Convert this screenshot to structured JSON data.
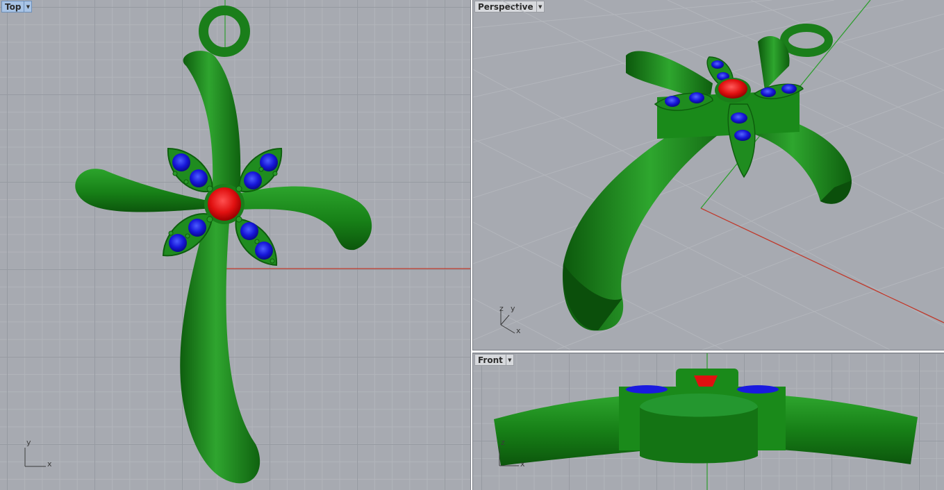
{
  "viewports": {
    "top": {
      "label": "Top",
      "axes": {
        "x": "x",
        "y": "y"
      }
    },
    "perspective": {
      "label": "Perspective",
      "axes": {
        "x": "x",
        "y": "y",
        "z": "z"
      }
    },
    "front": {
      "label": "Front",
      "axes": {
        "x": "x",
        "z": "z"
      }
    }
  },
  "icons": {
    "dropdown": "chevron-down-icon"
  },
  "colors": {
    "viewport_bg": "#a7aab1",
    "grid_minor": "#b2b5bb",
    "grid_major": "#969aa1",
    "x_axis": "#c0392b",
    "y_axis": "#2e9e2e",
    "metal": "#1e8a1e",
    "ruby": "#e01010",
    "sapphire": "#1a1adf"
  }
}
